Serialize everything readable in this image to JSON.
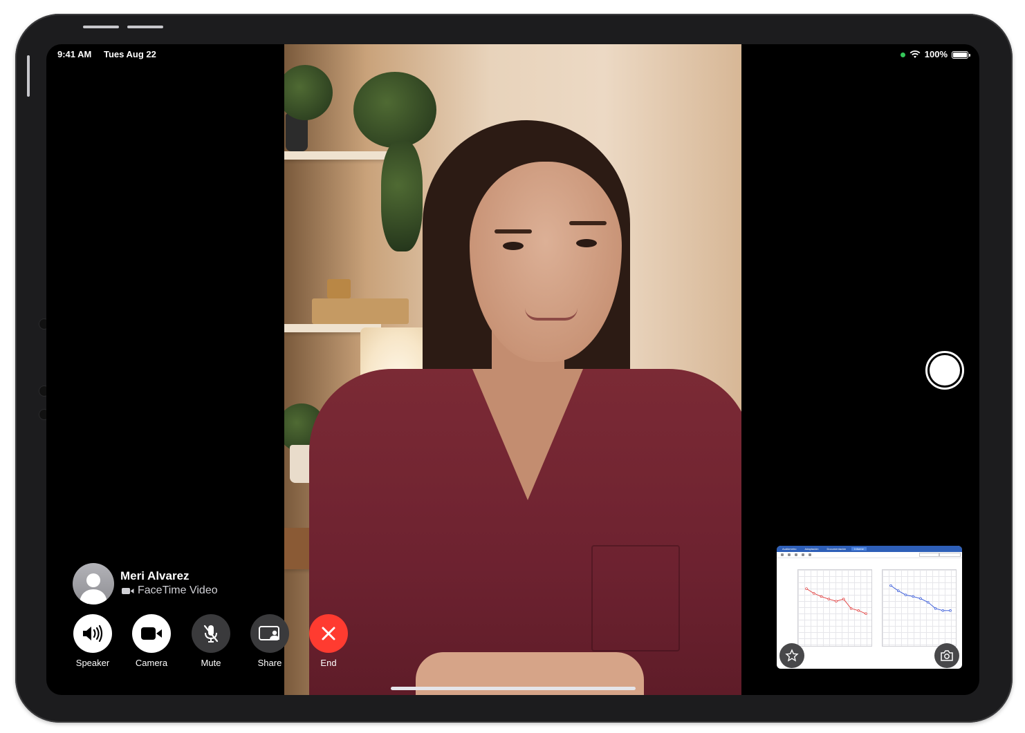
{
  "status_bar": {
    "time": "9:41 AM",
    "date": "Tues Aug 22",
    "battery": "100%"
  },
  "caller": {
    "name": "Meri Alvarez",
    "call_type": "FaceTime Video"
  },
  "controls": [
    {
      "id": "speaker",
      "label": "Speaker",
      "icon": "speaker-icon"
    },
    {
      "id": "camera",
      "label": "Camera",
      "icon": "video-camera-icon"
    },
    {
      "id": "mute",
      "label": "Mute",
      "icon": "microphone-slash-icon"
    },
    {
      "id": "share",
      "label": "Share",
      "icon": "share-screen-icon"
    },
    {
      "id": "end",
      "label": "End",
      "icon": "close-icon"
    }
  ],
  "colors": {
    "end_button": "#ff3b30",
    "active_dot": "#34c759",
    "pip_header": "#2e5fb8",
    "left_ear_series": "#e03a3a",
    "right_ear_series": "#2b4fd6"
  },
  "pip": {
    "tabs": [
      "Audiómetro",
      "Adaptación",
      "Documentación",
      "Informe"
    ]
  },
  "chart_data": [
    {
      "type": "line",
      "series": [
        {
          "values": [
            18,
            27,
            33,
            38,
            42,
            38,
            56,
            60,
            66
          ]
        }
      ],
      "ylim": [
        -10,
        120
      ],
      "grid": true
    },
    {
      "type": "line",
      "series": [
        {
          "values": [
            12,
            22,
            30,
            33,
            37,
            44,
            56,
            60,
            60
          ]
        }
      ],
      "ylim": [
        -10,
        120
      ],
      "grid": true
    }
  ]
}
